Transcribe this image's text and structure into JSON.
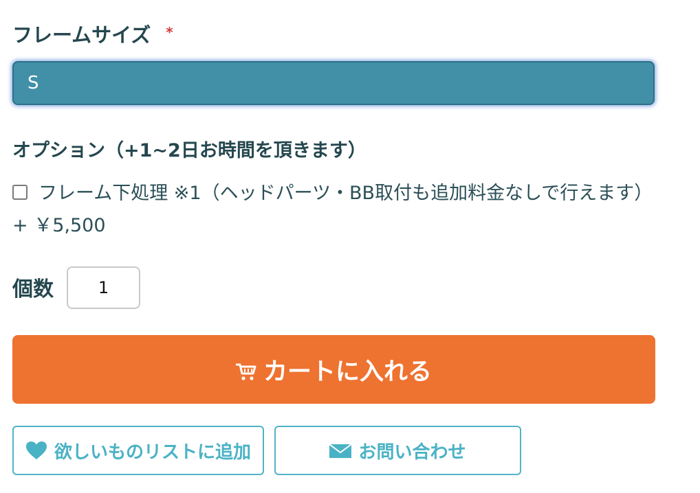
{
  "frame_size": {
    "label": "フレームサイズ",
    "required_mark": "*",
    "selected_value": "S"
  },
  "option": {
    "heading": "オプション（+1~2日お時間を頂きます）",
    "checkbox_label": "フレーム下処理 ※1（ヘッドパーツ・BB取付も追加料金なしで行えます）+ ￥5,500",
    "checked": false
  },
  "quantity": {
    "label": "個数",
    "value": "1"
  },
  "cart_button": {
    "label": "カートに入れる",
    "icon": "cart-icon"
  },
  "wishlist_button": {
    "label": "欲しいものリストに追加",
    "icon": "heart-icon"
  },
  "contact_button": {
    "label": "お問い合わせ",
    "icon": "envelope-icon"
  },
  "colors": {
    "select_bg": "#4190a8",
    "cart_bg": "#ee7230",
    "accent": "#4fb3c7",
    "heading_text": "#25474f",
    "required": "#d43b3b"
  }
}
